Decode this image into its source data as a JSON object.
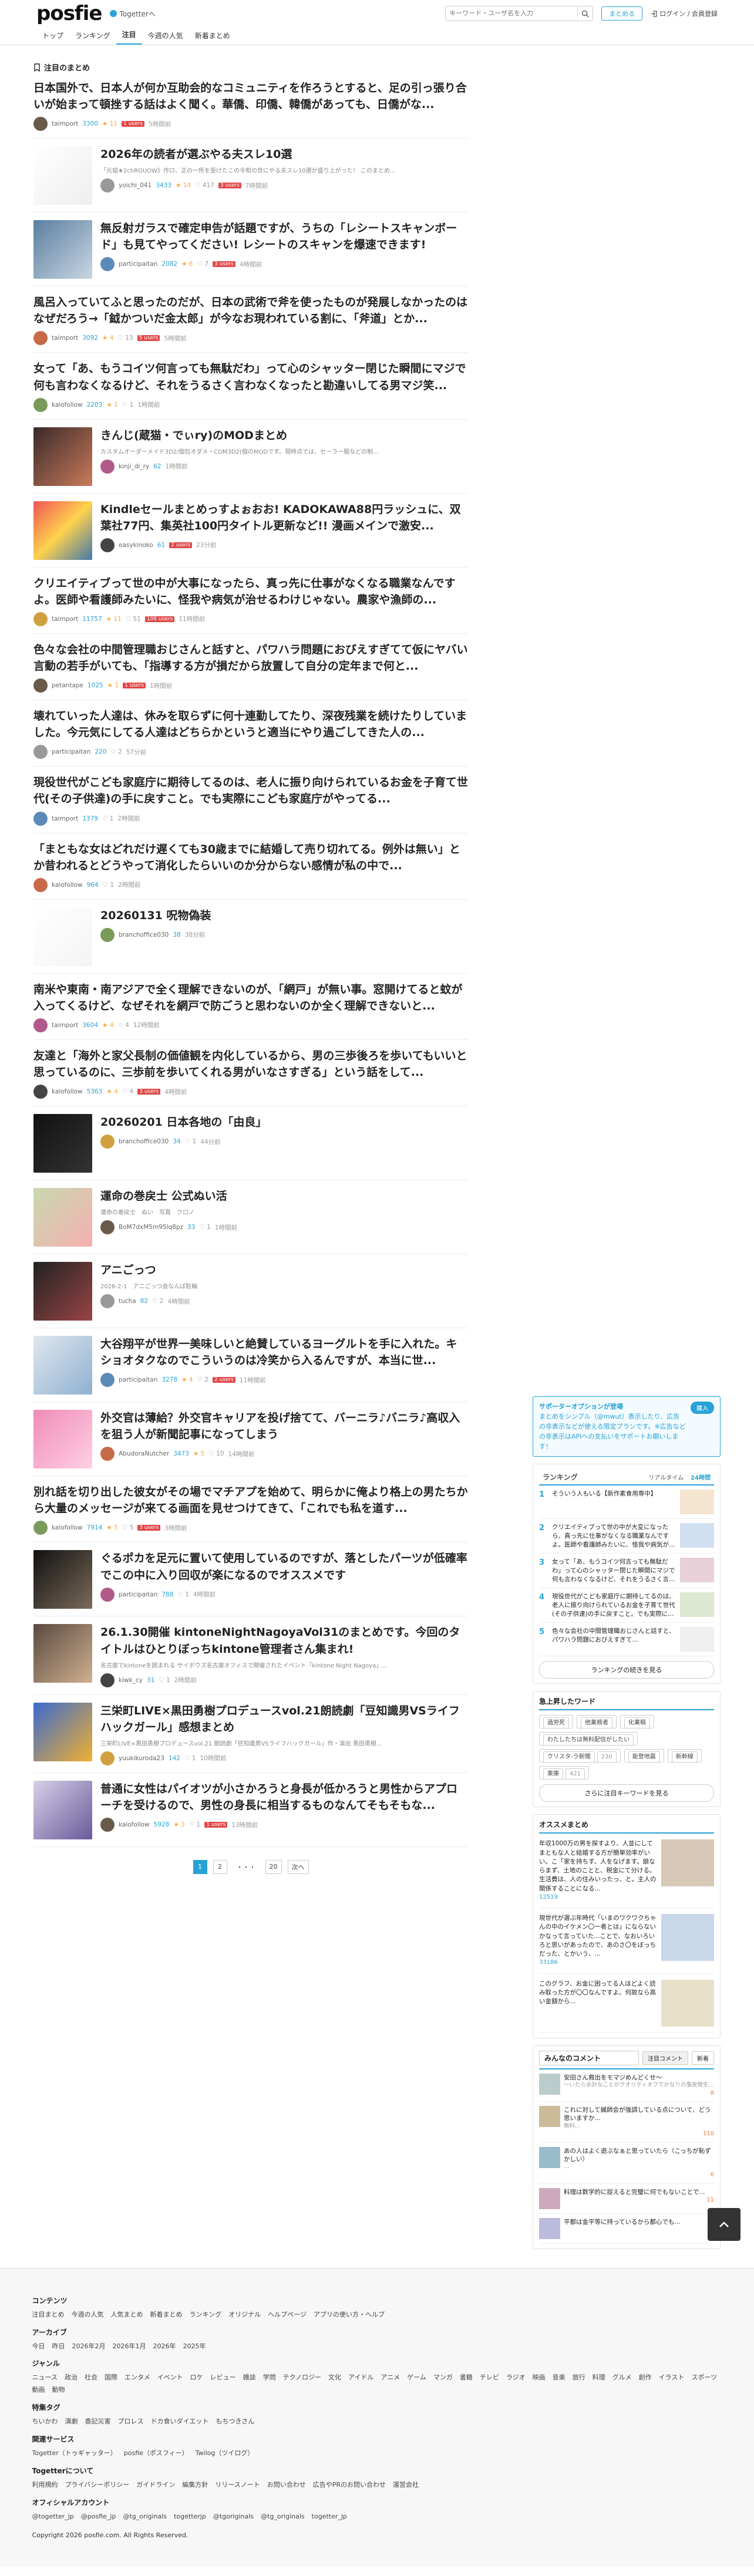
{
  "header": {
    "logo": "posfie",
    "togetter_link": "Togetterへ",
    "search_placeholder": "キーワード・ユーザ名を入力",
    "favorite_label": "まとめる",
    "login_label": "ログイン / 会員登録",
    "nav": [
      "トップ",
      "ランキング",
      "注目",
      "今週の人気",
      "新着まとめ"
    ]
  },
  "main": {
    "section_title": "注目のまとめ",
    "articles": [
      {
        "title": "日本国外で、日本人が何か互助会的なコミュニティを作ろうとすると、足の引っ張り合いが始まって頓挫する話はよく聞く。華僑、印僑、韓僑があっても、日僑がな...",
        "user": "taimport",
        "views": "3300",
        "likes": "11",
        "fav": "",
        "hot": "1 users",
        "bd": "5時間前"
      },
      {
        "title": "2026年の読者が選ぶやる夫スレ10選",
        "desc": "「元祖★2chRGUOW》作ロ、正の一所を受けたこの令和の世にやる夫スレ10選が盛り上がった！ このまとめ...",
        "user": "yoichi_041",
        "views": "3433",
        "likes": "14",
        "fav": "417",
        "hot": "3 users",
        "bd": "7時間前"
      },
      {
        "title": "無反射ガラスで確定申告が話題ですが、うちの「レシートスキャンボード」も見てやってください! レシートのスキャンを爆速できます!",
        "user": "participaitan",
        "views": "2082",
        "likes": "6",
        "fav": "7",
        "hot": "3 users",
        "bd": "4時間前"
      },
      {
        "title": "風呂入っていてふと思ったのだが、日本の武術で斧を使ったものが発展しなかったのはなぜだろう→「鉞かついだ金太郎」が今なお現われている割に、「斧道」とか...",
        "user": "taimport",
        "views": "3092",
        "likes": "4",
        "fav": "13",
        "hot": "5 users",
        "bd": "5時間前"
      },
      {
        "title": "女って「あ、もうコイツ何言っても無駄だわ」って心のシャッター閉じた瞬間にマジで何も言わなくなるけど、それをうるさく言わなくなったと勘違いしてる男マジ笑...",
        "user": "kalofollow",
        "views": "2203",
        "likes": "1",
        "fav": "1",
        "hot": "",
        "bd": "1時間前"
      },
      {
        "title": "きんじ(蔵猫・でぃry)のMODまとめ",
        "desc": "カスタムオーダーメイド3D2/個包オダメ・COM3D2(個のMODです。現時点では、セーラー服などの制...",
        "user": "kinji_di_ry",
        "views": "62",
        "likes": "",
        "fav": "",
        "hot": "",
        "bd": "1時間前"
      },
      {
        "title": "Kindleセールまとめっすよぉおお! KADOKAWA88円ラッシュに、双葉社77円、集英社100円タイトル更新など!! 漫画メインで激安...",
        "user": "easykinoko",
        "views": "61",
        "likes": "",
        "fav": "",
        "hot": "2 users",
        "bd": "23分前"
      },
      {
        "title": "クリエイティブって世の中が大事になったら、真っ先に仕事がなくなる職業なんですよ。医師や看護師みたいに、怪我や病気が治せるわけじゃない。農家や漁師の...",
        "user": "taimport",
        "views": "11757",
        "likes": "11",
        "fav": "51",
        "hot": "106 users",
        "bd": "11時間前"
      },
      {
        "title": "色々な会社の中間管理職おじさんと話すと、パワハラ問題におびえすぎてて仮にヤバい言動の若手がいても、「指導する方が損だから放置して自分の定年まで何と...",
        "user": "petantape",
        "views": "1025",
        "likes": "1",
        "fav": "",
        "hot": "1 users",
        "bd": "1時間前"
      },
      {
        "title": "壊れていった人達は、休みを取らずに何十連勤してたり、深夜残業を続けたりしていました。今元気にしてる人達はどちらかというと適当にやり過ごしてきた人の...",
        "user": "participaitan",
        "views": "220",
        "likes": "",
        "fav": "2",
        "hot": "",
        "bd": "57分前"
      },
      {
        "title": "現役世代がこども家庭庁に期待してるのは、老人に振り向けられているお金を子育て世代(その子供達)の手に戻すこと。でも実際にこども家庭庁がやってる...",
        "user": "taimport",
        "views": "1379",
        "likes": "",
        "fav": "1",
        "hot": "",
        "bd": "2時間前"
      },
      {
        "title": "「まともな女はどれだけ遅くても30歳までに結婚して売り切れてる。例外は無い」とか昔われるとどうやって消化したらいいのか分からない感情が私の中で...",
        "user": "kalofollow",
        "views": "964",
        "likes": "",
        "fav": "1",
        "hot": "",
        "bd": "2時間前"
      },
      {
        "title": "20260131 呪物偽装",
        "user": "branchoffice030",
        "views": "38",
        "likes": "",
        "fav": "",
        "hot": "",
        "bd": "38分前"
      },
      {
        "title": "南米や東南・南アジアで全く理解できないのが、「網戸」が無い事。窓開けてると蚊が入ってくるけど、なぜそれを網戸で防ごうと思わないのか全く理解できないと...",
        "user": "taimport",
        "views": "3604",
        "likes": "4",
        "fav": "4",
        "hot": "",
        "bd": "12時間前"
      },
      {
        "title": "友達と「海外と家父長制の価値観を内化しているから、男の三歩後ろを歩いてもいいと思っているのに、三歩前を歩いてくれる男がいなさすぎる」という話をして...",
        "user": "kalofollow",
        "views": "5363",
        "likes": "4",
        "fav": "4",
        "hot": "3 users",
        "bd": "4時間前"
      },
      {
        "title": "20260201 日本各地の「由良」",
        "user": "branchoffice030",
        "views": "34",
        "likes": "",
        "fav": "1",
        "hot": "",
        "bd": "44分前"
      },
      {
        "title": "運命の巻戻士 公式ぬい活",
        "desc": "運命の巻戻士　ぬい　写真　クロノ",
        "user": "BoM7dxM5m95lq8pz",
        "views": "33",
        "likes": "",
        "fav": "1",
        "hot": "",
        "bd": "1時間前"
      },
      {
        "title": "アニごっつ",
        "desc": "2026-2-1　アニごっつ会なんば駐輪",
        "user": "tucha",
        "views": "82",
        "likes": "",
        "fav": "2",
        "hot": "",
        "bd": "4時間前"
      },
      {
        "title": "大谷翔平が世界一美味しいと絶賛しているヨーグルトを手に入れた。キショオタクなのでこういうのは冷笑から入るんですが、本当に世...",
        "user": "participaitan",
        "views": "3278",
        "likes": "4",
        "fav": "2",
        "hot": "2 users",
        "bd": "11時間前"
      },
      {
        "title": "外交官は薄給？外交官キャリアを投げ捨てて、バーニラ♪バニラ♪高収入を狙う人が新聞記事になってしまう",
        "user": "AbudoraNutcher",
        "views": "3473",
        "likes": "5",
        "fav": "10",
        "hot": "",
        "bd": "14時間前"
      },
      {
        "title": "別れ話を切り出した彼女がその場でマチアプを始めて、明らかに俺より格上の男たちから大量のメッセージが来てる画面を見せつけてきて、「これでも私を道す...",
        "user": "kalofollow",
        "views": "7914",
        "likes": "5",
        "fav": "5",
        "hot": "3 users",
        "bd": "3時間前"
      },
      {
        "title": "ぐるポカを足元に置いて使用しているのですが、落としたパーツが低確率でこの中に入り回収が楽になるのでオススメです",
        "user": "participaitan",
        "views": "788",
        "likes": "",
        "fav": "1",
        "hot": "",
        "bd": "4時間前"
      },
      {
        "title": "26.1.30開催 kintoneNightNagoyaVol31のまとめです。今回のタイトルはひとりぼっちkintone管理者さん集まれ!",
        "desc": "名古屋でkintoneを囲まれる サイボウズ名古屋オフィスで開催されたイベント「kintone Night Nagoya」...",
        "user": "kiwk_cy",
        "views": "31",
        "likes": "",
        "fav": "1",
        "hot": "",
        "bd": "2時間前"
      },
      {
        "title": "三栄町LIVE×黒田勇樹プロデュースvol.21朗読劇「豆知識男VSライフハックガール」感想まとめ",
        "desc": "三栄町LIVE×黒田勇樹プロデュースvol.21 朗読劇「豆知識男VSライフハックガール」作・演出 黒田勇樹...",
        "user": "yuukikuroda23",
        "views": "142",
        "likes": "",
        "fav": "1",
        "hot": "",
        "bd": "10時間前"
      },
      {
        "title": "普通に女性はパイオツが小さかろうと身長が低かろうと男性からアプローチを受けるので、男性の身長に相当するものなんてそもそもな...",
        "user": "kalofollow",
        "views": "5928",
        "likes": "3",
        "fav": "1",
        "hot": "1 users",
        "bd": "13時間前"
      }
    ],
    "pager": [
      "1",
      "2",
      "・・・",
      "20",
      "次へ"
    ]
  },
  "side": {
    "supporter": {
      "title": "サポーターオプションが登場",
      "body": "まとめをシンプル（@mwut）表示したり、広告の非表示などが使える限定プランです。※広告などの非表示はAPIへの支払いをサポートお願いします！",
      "btn": "購入"
    },
    "ranking": {
      "title": "ランキング",
      "tabs": [
        "リアルタイム",
        "24時間"
      ],
      "items": [
        {
          "rank": "1",
          "text": "そういう人もいる【新作素食用専中】"
        },
        {
          "rank": "2",
          "text": "クリエイティブって世の中が大変になったら、真っ先に仕事がなくなる職業なんですよ。医師や看護師みたいに、怪我や病気が治せるわけじゃない..."
        },
        {
          "rank": "3",
          "text": "女って「あ、もうコイツ何言っても無駄だわ」って心のシャッター閉じた瞬間にマジで何も言わなくなるけど、それをうるさく言わなくなったと勘違いしてる男..."
        },
        {
          "rank": "4",
          "text": "現役世代がこども家庭庁に期待してるのは、老人に振り向けられているお金を子育て世代(その子供達)の手に戻すこと。でも実際にこども家庭庁がやってるのは..."
        },
        {
          "rank": "5",
          "text": "色々な会社の中間管理職おじさんと話すと、パワハラ問題におびえすぎて..."
        }
      ],
      "more": "ランキングの続きを見る"
    },
    "keywords": {
      "title": "急上昇したワード",
      "items": [
        "過労死",
        "他業務者",
        "化業稿",
        "わたしたちは無料配信がしたい",
        "クリスタ-ラ新聞",
        "能登地震",
        "新幹線",
        "東庫"
      ],
      "counts": [
        "",
        "",
        "",
        "",
        "230",
        "",
        "",
        "421"
      ],
      "more": "さらに注目キーワードを見る"
    },
    "osusume": {
      "title": "オススメまとめ",
      "items": [
        {
          "text": "年収1000万の男を探すより、人並にしてまともな人と結婚する方が簡単効率がいい。こ「家を持ちす、人をなげます。娘ならまず、土地のことと、税金にて分ける。生活費は、人の住みいったっ、と。主人の関係することになる...",
          "views": "12519"
        },
        {
          "text": "現世代が選ぶ年時代「いまのワクワクちゃんの中のイケメン〇一者とは」にならないかなって言っていた...ことで、なおいろいろと思いがあったので、あのさ〇をぼっちだった、とかいう、...",
          "views": "33186"
        },
        {
          "text": "このグラフ、お金に困ってる人ほどよく読み取った方が〇〇なんですよ。何故なら高い金額から...",
          "views": ""
        }
      ]
    },
    "comments": {
      "title": "みんなのコメント",
      "tabs": [
        "注目コメント",
        "新着"
      ],
      "items": [
        {
          "text": "安田さん救出をモマジめんどくせ〜",
          "sub": "〜いたら余計なことがクオリティオフでかなりの事故発生...",
          "count": "8"
        },
        {
          "text": "これに対して鍼師会が強調している点について、どう思いますか...",
          "sub": "無料...",
          "count": "110"
        },
        {
          "text": "あの人はよく遊ぶなぁと思っていたら（こっちが恥ずかしい）",
          "sub": "...",
          "count": "6"
        },
        {
          "text": "料理は数学的に捉えると完璧に何でもないことで...",
          "sub": "",
          "count": "11"
        },
        {
          "text": "平都は金平等に持っているから都心でも...",
          "sub": "",
          "count": "11"
        }
      ]
    }
  },
  "footer": {
    "sections": [
      {
        "h": "コンテンツ",
        "links": [
          "注目まとめ",
          "今週の人気",
          "人気まとめ",
          "新着まとめ",
          "ランキング",
          "オリジナル",
          "ヘルプページ",
          "アプリの使い方・ヘルプ"
        ]
      },
      {
        "h": "アーカイブ",
        "links": [
          "今日",
          "昨日",
          "2026年2月",
          "2026年1月",
          "2026年",
          "2025年"
        ]
      },
      {
        "h": "ジャンル",
        "links": [
          "ニュース",
          "政治",
          "社会",
          "国際",
          "エンタメ",
          "イベント",
          "ロケ",
          "レビュー",
          "雑談",
          "学問",
          "テクノロジー",
          "文化",
          "アイドル",
          "アニメ",
          "ゲーム",
          "マンガ",
          "書籍",
          "テレビ",
          "ラジオ",
          "映画",
          "音楽",
          "旅行",
          "料理",
          "グルメ",
          "創作",
          "イラスト",
          "スポーツ",
          "動画",
          "動物"
        ]
      },
      {
        "h": "特集タグ",
        "links": [
          "ちいかわ",
          "演劇",
          "香記災害",
          "プロレス",
          "ドカ食いダイエット",
          "もちつきさん"
        ]
      },
      {
        "h": "関連サービス",
        "links": [
          "Togetter（トゥギャッター）",
          "posfie（ポスフィー）",
          "Twilog（ツイログ）"
        ]
      },
      {
        "h": "Togetterについて",
        "links": [
          "利用規約",
          "プライバシーポリシー",
          "ガイドライン",
          "編集方針",
          "リリースノート",
          "お問い合わせ",
          "広告やPRのお問い合わせ",
          "運営会社"
        ]
      },
      {
        "h": "オフィシャルアカウント",
        "links": [
          "@togetter_jp",
          "@posfie_jp",
          "@tg_originals",
          "togetterjp",
          "@tgoriginals",
          "@tg_originals",
          "togetter_jp"
        ]
      }
    ],
    "copyright": "Copyright 2026 posfie.com. All Rights Reserved."
  },
  "colors": {
    "accent": "#29a3d6",
    "hot": "#e04848",
    "like": "#f7a83b"
  }
}
